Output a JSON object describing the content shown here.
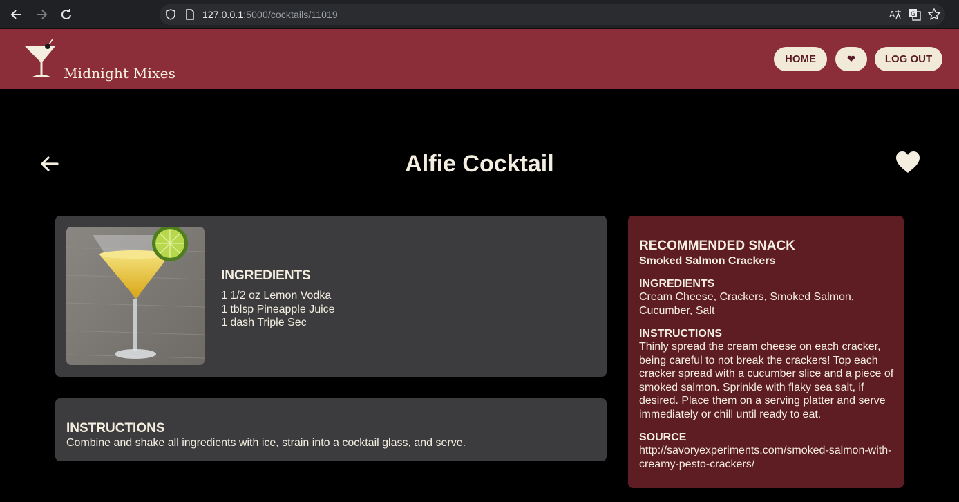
{
  "browser": {
    "url_host": "127.0.0.1",
    "url_path": ":5000/cocktails/11019"
  },
  "site": {
    "brand": "Midnight Mixes",
    "nav": {
      "home": "HOME",
      "favorites": "❤",
      "logout": "LOG OUT"
    }
  },
  "cocktail": {
    "title": "Alfie Cocktail",
    "ingredients_heading": "INGREDIENTS",
    "ingredients": [
      "1 1/2 oz Lemon Vodka",
      "1 tblsp Pineapple Juice",
      "1 dash Triple Sec"
    ],
    "instructions_heading": "INSTRUCTIONS",
    "instructions": "Combine and shake all ingredients with ice, strain into a cocktail glass, and serve."
  },
  "snack": {
    "heading": "RECOMMENDED SNACK",
    "name": "Smoked Salmon Crackers",
    "ingredients_heading": "INGREDIENTS",
    "ingredients": "Cream Cheese, Crackers, Smoked Salmon, Cucumber, Salt",
    "instructions_heading": "INSTRUCTIONS",
    "instructions": "Thinly spread the cream cheese on each cracker, being careful to not break the crackers! Top each cracker spread with a cucumber slice and a piece of smoked salmon. Sprinkle with flaky sea salt, if desired. Place them on a serving platter and serve immediately or chill until ready to eat.",
    "source_heading": "SOURCE",
    "source": "http://savoryexperiments.com/smoked-salmon-with-creamy-pesto-crackers/"
  },
  "colors": {
    "header": "#8c2e3a",
    "card": "#3c3c3e",
    "snack_card": "#5e1c23",
    "cream": "#f4eee0"
  }
}
